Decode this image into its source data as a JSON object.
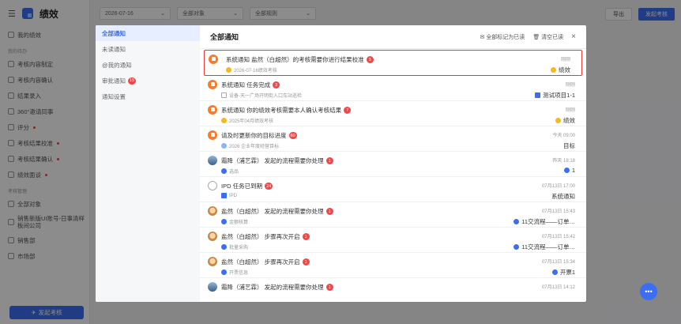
{
  "app": {
    "title": "绩效",
    "primary_button": "发起考核"
  },
  "sidebar": {
    "items_top": [
      {
        "label": "我的绩效"
      }
    ],
    "section_todo": "我的待办",
    "todo_items": [
      {
        "label": "考核内容制定"
      },
      {
        "label": "考核内容确认"
      },
      {
        "label": "结果录入"
      },
      {
        "label": "360°邀请同事"
      },
      {
        "label": "评分"
      },
      {
        "label": "考核结果校准"
      },
      {
        "label": "考核结果确认"
      },
      {
        "label": "绩效面谈"
      }
    ],
    "section_manage": "考核管理",
    "manage_items": [
      {
        "label": "全部对象"
      },
      {
        "label": "销售新版UI账号-日事清样板间公司"
      },
      {
        "label": "销售部"
      },
      {
        "label": "市场部"
      }
    ]
  },
  "topbar": {
    "date": "2026-07-16",
    "object": "全部对象",
    "rule": "全部规则",
    "export": "导出",
    "launch": "发起考核"
  },
  "modal": {
    "title": "全部通知",
    "mark_all": "全部标记为已读",
    "clear_read": "清空已读",
    "close": "×",
    "side_items": [
      {
        "label": "全部通知"
      },
      {
        "label": "未读通知"
      },
      {
        "label": "@我的通知"
      },
      {
        "label": "审批通知",
        "badge": "15"
      },
      {
        "label": "通知设置"
      }
    ],
    "notifications": [
      {
        "title": "系统通知  盐然（白超然）的考核需要你进行结果校准",
        "badge": "3",
        "sub": "2026-07-16绩效考核",
        "time": "刚刚",
        "right": "绩效"
      },
      {
        "title": "系统通知  任务完成",
        "badge": "3",
        "sub": "设备-天一广场开明街入口车站巡检",
        "time": "刚刚",
        "right": "测试项目1-1"
      },
      {
        "title": "系统通知  你的绩效考核需要本人确认考核结果",
        "badge": "7",
        "sub": "2025年04月绩效考核",
        "time": "刚刚",
        "right": "绩效"
      },
      {
        "title": "请及时更新你的目标进度",
        "badge": "60",
        "sub": "2026 企业年度经营目标",
        "time": "今天 09:00",
        "right": "目标"
      },
      {
        "title": "霜降（浦艺霖）  发起的流程需要你处理",
        "badge": "1",
        "sub": "选品",
        "time": "昨天 18:18",
        "right": "1"
      },
      {
        "title": "IPD  任务已到期",
        "badge": "24",
        "sub": "IPD",
        "time": "07月13日 17:00",
        "right": "系统通知"
      },
      {
        "title": "盐然（白超然）  发起的流程需要你处理",
        "badge": "1",
        "sub": "金额核算",
        "time": "07月13日 15:43",
        "right": "11交流程——订单…"
      },
      {
        "title": "盐然（白超然）  步骤再次开启",
        "badge": "1",
        "sub": "批量采购",
        "time": "07月13日 15:42",
        "right": "11交流程——订单…"
      },
      {
        "title": "盐然（白超然）  步骤再次开启",
        "badge": "1",
        "sub": "开票信息",
        "time": "07月13日 15:34",
        "right": "开票1"
      },
      {
        "title": "霜降（浦艺霖）  发起的流程需要你处理",
        "badge": "1",
        "sub": "",
        "time": "07月13日 14:12",
        "right": ""
      }
    ]
  },
  "colors": {
    "accent": "#3b6ef5",
    "danger": "#f04848",
    "highlight_border": "#e53935"
  }
}
